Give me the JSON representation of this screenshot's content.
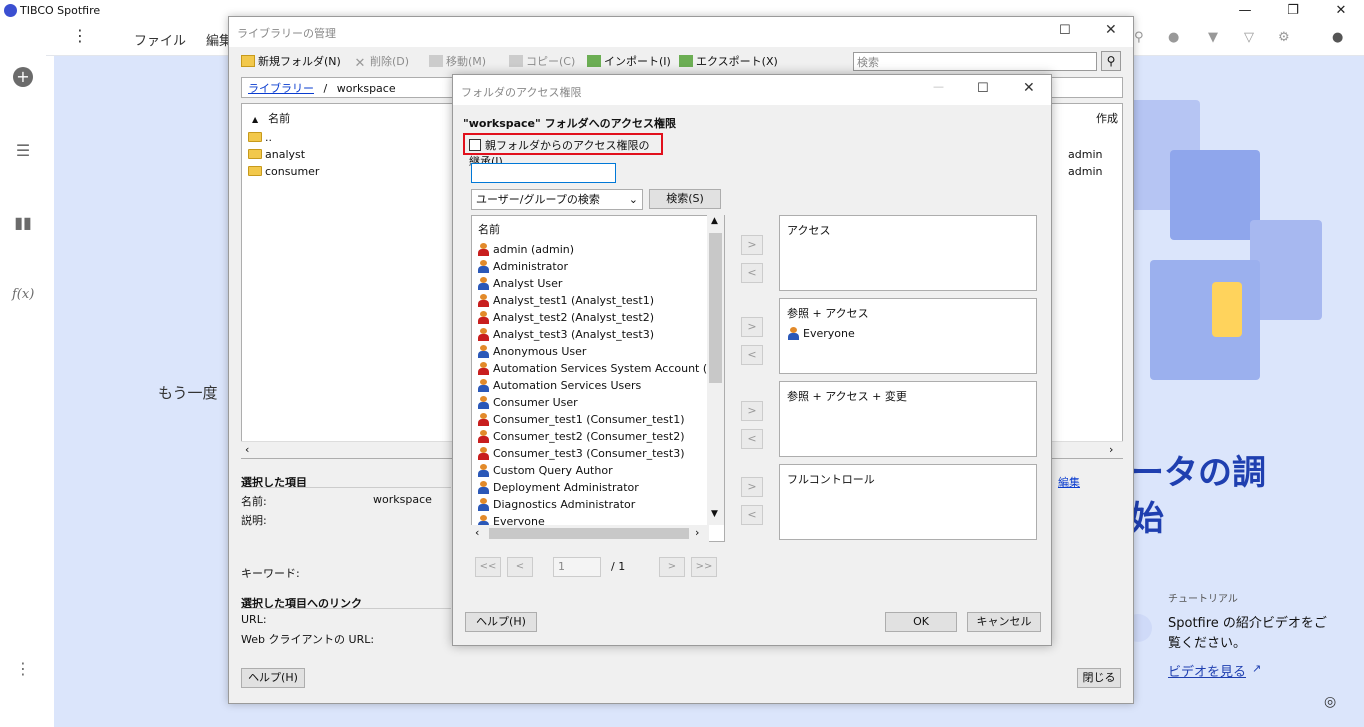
{
  "app": {
    "title": "TIBCO Spotfire"
  },
  "appbar": {
    "file_menu": "ファイル",
    "edit_menu": "編集"
  },
  "background": {
    "again_text": "もう一度",
    "hero_line1": "ータの調",
    "hero_line2": "始",
    "tutorial_label": "チュートリアル",
    "tutorial_text": "Spotfire の紹介ビデオをご覧ください。",
    "tutorial_link": "ビデオを見る"
  },
  "library": {
    "title": "ライブラリーの管理",
    "toolbar": {
      "new_folder": "新規フォルダ(N)",
      "delete": "削除(D)",
      "move": "移動(M)",
      "copy": "コピー(C)",
      "import": "インポート(I)",
      "export": "エクスポート(X)"
    },
    "search_placeholder": "検索",
    "breadcrumb": {
      "root": "ライブラリー",
      "sep": "/",
      "current": "workspace"
    },
    "list": {
      "col_name": "名前",
      "col_created": "作成",
      "rows": [
        {
          "name": "..",
          "created": ""
        },
        {
          "name": "analyst",
          "created": "admin"
        },
        {
          "name": "consumer",
          "created": "admin"
        }
      ]
    },
    "selected": {
      "heading": "選択した項目",
      "name_label": "名前:",
      "name_value": "workspace",
      "desc_label": "説明:",
      "keyword_label": "キーワード:",
      "edit_link": "編集"
    },
    "links": {
      "heading": "選択した項目へのリンク",
      "url_label": "URL:",
      "web_url_label": "Web クライアントの URL:"
    },
    "help_button": "ヘルプ(H)",
    "close_button": "閉じる"
  },
  "dialog": {
    "title": "フォルダのアクセス権限",
    "heading": "\"workspace\" フォルダへのアクセス権限",
    "inherit_checkbox": "親フォルダからのアクセス権限の継承(I)",
    "search_value": "",
    "search_type": "ユーザー/グループの検索",
    "search_button": "検索(S)",
    "user_list_header": "名前",
    "users": [
      {
        "name": "admin (admin)",
        "kind": "user"
      },
      {
        "name": "Administrator",
        "kind": "group"
      },
      {
        "name": "Analyst User",
        "kind": "group"
      },
      {
        "name": "Analyst_test1 (Analyst_test1)",
        "kind": "user"
      },
      {
        "name": "Analyst_test2 (Analyst_test2)",
        "kind": "user"
      },
      {
        "name": "Analyst_test3 (Analyst_test3)",
        "kind": "user"
      },
      {
        "name": "Anonymous User",
        "kind": "group"
      },
      {
        "name": "Automation Services System Account (auto...",
        "kind": "user"
      },
      {
        "name": "Automation Services Users",
        "kind": "group"
      },
      {
        "name": "Consumer User",
        "kind": "group"
      },
      {
        "name": "Consumer_test1 (Consumer_test1)",
        "kind": "user"
      },
      {
        "name": "Consumer_test2 (Consumer_test2)",
        "kind": "user"
      },
      {
        "name": "Consumer_test3 (Consumer_test3)",
        "kind": "user"
      },
      {
        "name": "Custom Query Author",
        "kind": "group"
      },
      {
        "name": "Deployment Administrator",
        "kind": "group"
      },
      {
        "name": "Diagnostics Administrator",
        "kind": "group"
      },
      {
        "name": "Everyone",
        "kind": "group"
      }
    ],
    "permission_boxes": [
      {
        "label": "アクセス",
        "members": []
      },
      {
        "label": "参照 + アクセス",
        "members": [
          "Everyone"
        ]
      },
      {
        "label": "参照 + アクセス + 変更",
        "members": []
      },
      {
        "label": "フルコントロール",
        "members": []
      }
    ],
    "pager": {
      "first": "<<",
      "prev": "<",
      "page": "1",
      "total": "/ 1",
      "next": ">",
      "last": ">>"
    },
    "add_arrow": ">",
    "remove_arrow": "<",
    "help_button": "ヘルプ(H)",
    "ok_button": "OK",
    "cancel_button": "キャンセル"
  }
}
